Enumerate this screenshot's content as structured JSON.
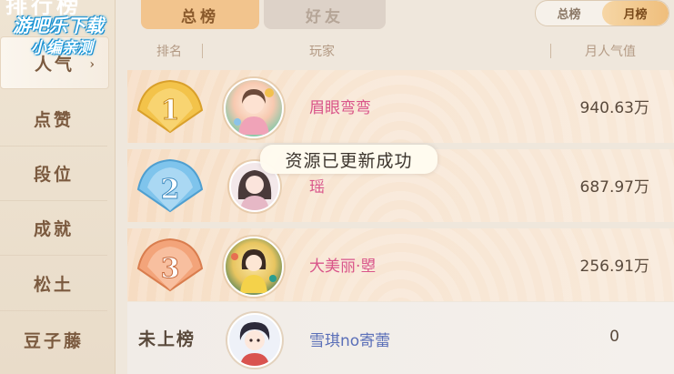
{
  "sidebar": {
    "cut_title": "排行榜",
    "active": {
      "label": "人气",
      "arrow": "›"
    },
    "items": [
      {
        "label": "点赞"
      },
      {
        "label": "段位"
      },
      {
        "label": "成就"
      },
      {
        "label": "松土"
      },
      {
        "label": "豆子藤"
      }
    ]
  },
  "watermark": {
    "line1": "游吧乐下载",
    "line2": "小编亲测"
  },
  "tabs": [
    {
      "label": "总榜"
    },
    {
      "label": "好友"
    }
  ],
  "period_toggle": {
    "options": [
      "总榜",
      "月榜"
    ],
    "selected": "月榜"
  },
  "table": {
    "headers": {
      "rank": "排名",
      "player": "玩家",
      "score": "月人气值"
    },
    "rows": [
      {
        "rank": "1",
        "name": "眉眼弯弯",
        "score": "940.63万",
        "badge_color": "#f3c34a"
      },
      {
        "rank": "2",
        "name": "瑶",
        "score": "687.97万",
        "badge_color": "#7fc4ec"
      },
      {
        "rank": "3",
        "name": "大美丽·曌",
        "score": "256.91万",
        "badge_color": "#f3a47a"
      }
    ],
    "self": {
      "rank_text": "未上榜",
      "name": "雪琪no寄蕾",
      "score": "0"
    }
  },
  "toast": {
    "text": "资源已更新成功"
  },
  "colors": {
    "accent": "#f2c48d",
    "name_pink": "#d9558a",
    "name_blue": "#5a6fb8"
  }
}
